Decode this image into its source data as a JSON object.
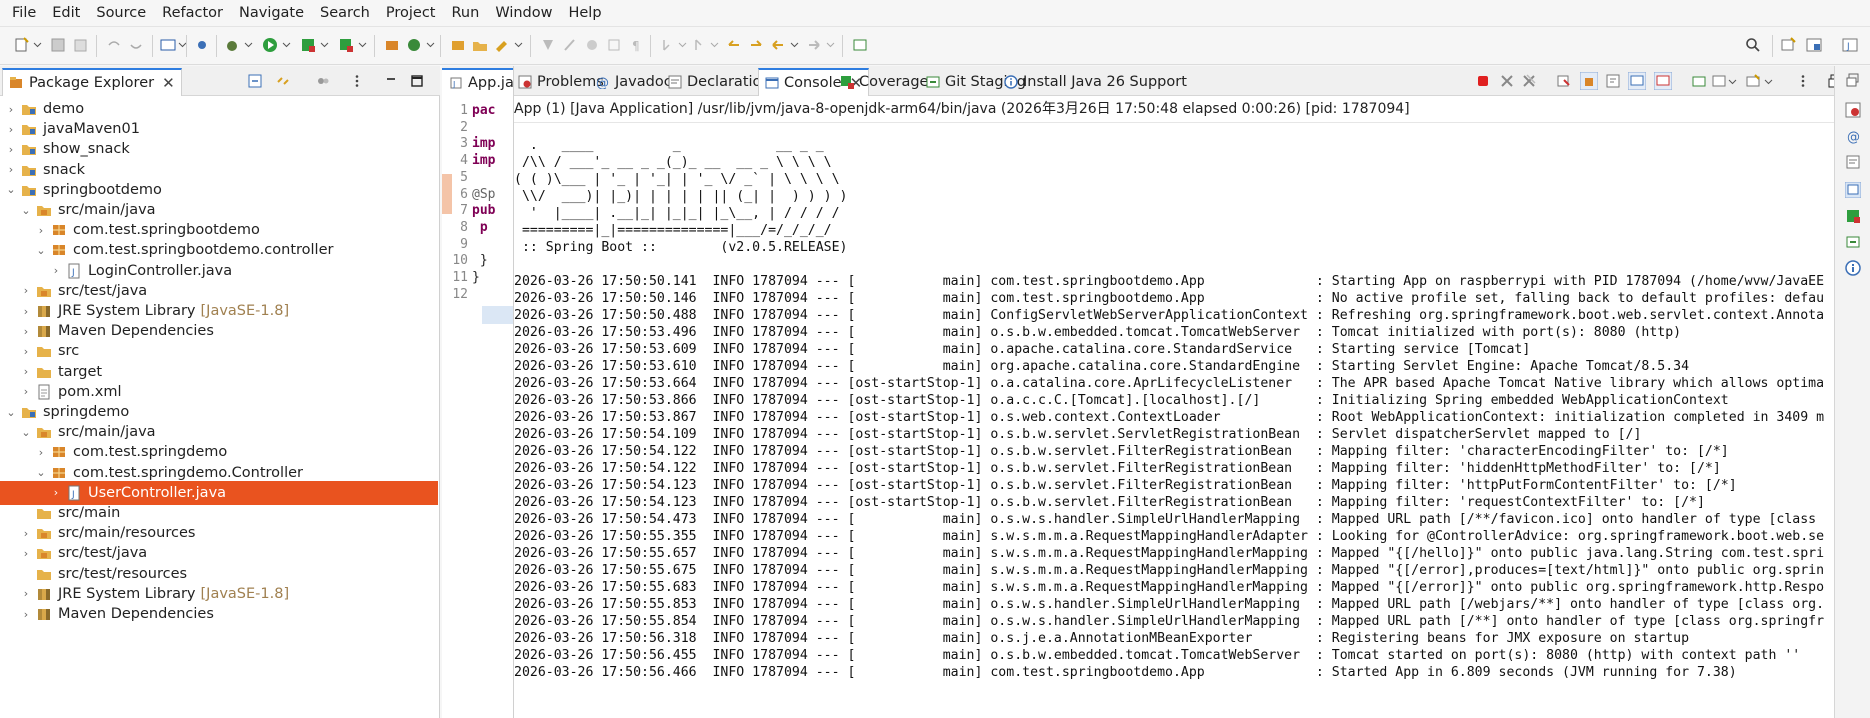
{
  "menu": [
    "File",
    "Edit",
    "Source",
    "Refactor",
    "Navigate",
    "Search",
    "Project",
    "Run",
    "Window",
    "Help"
  ],
  "package_explorer": {
    "title": "Package Explorer",
    "close": "✕",
    "tree": [
      {
        "label": "demo",
        "decor": "",
        "icon": "project-icon",
        "expanded": false
      },
      {
        "label": "javaMaven01",
        "decor": "",
        "icon": "project-icon",
        "expanded": false
      },
      {
        "label": "show_snack",
        "decor": "",
        "icon": "project-icon",
        "expanded": false
      },
      {
        "label": "snack",
        "decor": "",
        "icon": "project-icon",
        "expanded": false
      },
      {
        "label": "springbootdemo",
        "decor": "",
        "icon": "project-icon",
        "expanded": true
      },
      {
        "label": "src/main/java",
        "decor": "",
        "icon": "source-folder-icon",
        "expanded": true
      },
      {
        "label": "com.test.springbootdemo",
        "decor": "",
        "icon": "package-icon",
        "expanded": false
      },
      {
        "label": "com.test.springbootdemo.controller",
        "decor": "",
        "icon": "package-icon",
        "expanded": true
      },
      {
        "label": "LoginController.java",
        "decor": "",
        "icon": "java-file-icon",
        "expanded": false
      },
      {
        "label": "src/test/java",
        "decor": "",
        "icon": "source-folder-icon",
        "expanded": false
      },
      {
        "label": "JRE System Library",
        "decor": "[JavaSE-1.8]",
        "icon": "library-icon",
        "expanded": false
      },
      {
        "label": "Maven Dependencies",
        "decor": "",
        "icon": "library-icon",
        "expanded": false
      },
      {
        "label": "src",
        "decor": "",
        "icon": "folder-icon",
        "expanded": false
      },
      {
        "label": "target",
        "decor": "",
        "icon": "folder-icon",
        "expanded": false
      },
      {
        "label": "pom.xml",
        "decor": "",
        "icon": "xml-file-icon",
        "expanded": false
      },
      {
        "label": "springdemo",
        "decor": "",
        "icon": "project-icon",
        "expanded": true
      },
      {
        "label": "src/main/java",
        "decor": "",
        "icon": "source-folder-icon",
        "expanded": true
      },
      {
        "label": "com.test.springdemo",
        "decor": "",
        "icon": "package-icon",
        "expanded": false
      },
      {
        "label": "com.test.springdemo.Controller",
        "decor": "",
        "icon": "package-icon",
        "expanded": true
      },
      {
        "label": "UserController.java",
        "decor": "",
        "icon": "java-file-icon",
        "expanded": false,
        "selected": true
      },
      {
        "label": "src/main",
        "decor": "",
        "icon": "folder-icon",
        "expanded": null
      },
      {
        "label": "src/main/resources",
        "decor": "",
        "icon": "source-folder-icon",
        "expanded": false
      },
      {
        "label": "src/test/java",
        "decor": "",
        "icon": "source-folder-icon",
        "expanded": false
      },
      {
        "label": "src/test/resources",
        "decor": "",
        "icon": "folder-icon",
        "expanded": null
      },
      {
        "label": "JRE System Library",
        "decor": "[JavaSE-1.8]",
        "icon": "library-icon",
        "expanded": false
      },
      {
        "label": "Maven Dependencies",
        "decor": "",
        "icon": "library-icon",
        "expanded": false
      }
    ]
  },
  "editor": {
    "tab_label": "App.ja",
    "lines": [
      {
        "n": "1",
        "code": "pac",
        "style": "kw"
      },
      {
        "n": "2",
        "code": "",
        "style": "plain"
      },
      {
        "n": "3",
        "code": "imp",
        "style": "kw"
      },
      {
        "n": "4",
        "code": "imp",
        "style": "kw"
      },
      {
        "n": "5",
        "code": "",
        "style": "plain"
      },
      {
        "n": "6",
        "code": "@Sp",
        "style": "ann"
      },
      {
        "n": "7",
        "code": "pub",
        "style": "kw"
      },
      {
        "n": "8",
        "code": "  p",
        "style": "kw"
      },
      {
        "n": "9",
        "code": "",
        "style": "plain"
      },
      {
        "n": "10",
        "code": "  }",
        "style": "plain"
      },
      {
        "n": "11",
        "code": "}",
        "style": "plain"
      },
      {
        "n": "12",
        "code": "",
        "style": "plain"
      }
    ]
  },
  "console_tabs": [
    {
      "label": "Problems",
      "icon": "problems-icon"
    },
    {
      "label": "Javadoc",
      "icon": "at-icon"
    },
    {
      "label": "Declaration",
      "icon": "declaration-icon"
    },
    {
      "label": "Console",
      "icon": "console-icon",
      "active": true
    },
    {
      "label": "Coverage",
      "icon": "coverage-icon"
    },
    {
      "label": "Git Staging",
      "icon": "git-icon"
    },
    {
      "label": "Install Java 26 Support",
      "icon": "info-icon"
    }
  ],
  "console": {
    "description": "App (1) [Java Application] /usr/lib/jvm/java-8-openjdk-arm64/bin/java  (2026年3月26日 17:50:48 elapsed 0:00:26) [pid: 1787094]",
    "lines": [
      "  .   ____          _            __ _ _",
      " /\\\\ / ___'_ __ _ _(_)_ __  __ _ \\ \\ \\ \\",
      "( ( )\\___ | '_ | '_| | '_ \\/ _` | \\ \\ \\ \\",
      " \\\\/  ___)| |_)| | | | | || (_| |  ) ) ) )",
      "  '  |____| .__|_| |_|_| |_\\__, | / / / /",
      " =========|_|==============|___/=/_/_/_/",
      " :: Spring Boot ::        (v2.0.5.RELEASE)",
      "",
      "2026-03-26 17:50:50.141  INFO 1787094 --- [           main] com.test.springbootdemo.App              : Starting App on raspberrypi with PID 1787094 (/home/wvw/JavaEE",
      "2026-03-26 17:50:50.146  INFO 1787094 --- [           main] com.test.springbootdemo.App              : No active profile set, falling back to default profiles: defau",
      "2026-03-26 17:50:50.488  INFO 1787094 --- [           main] ConfigServletWebServerApplicationContext : Refreshing org.springframework.boot.web.servlet.context.Annota",
      "2026-03-26 17:50:53.496  INFO 1787094 --- [           main] o.s.b.w.embedded.tomcat.TomcatWebServer  : Tomcat initialized with port(s): 8080 (http)",
      "2026-03-26 17:50:53.609  INFO 1787094 --- [           main] o.apache.catalina.core.StandardService   : Starting service [Tomcat]",
      "2026-03-26 17:50:53.610  INFO 1787094 --- [           main] org.apache.catalina.core.StandardEngine  : Starting Servlet Engine: Apache Tomcat/8.5.34",
      "2026-03-26 17:50:53.664  INFO 1787094 --- [ost-startStop-1] o.a.catalina.core.AprLifecycleListener   : The APR based Apache Tomcat Native library which allows optima",
      "2026-03-26 17:50:53.866  INFO 1787094 --- [ost-startStop-1] o.a.c.c.C.[Tomcat].[localhost].[/]       : Initializing Spring embedded WebApplicationContext",
      "2026-03-26 17:50:53.867  INFO 1787094 --- [ost-startStop-1] o.s.web.context.ContextLoader            : Root WebApplicationContext: initialization completed in 3409 m",
      "2026-03-26 17:50:54.109  INFO 1787094 --- [ost-startStop-1] o.s.b.w.servlet.ServletRegistrationBean  : Servlet dispatcherServlet mapped to [/]",
      "2026-03-26 17:50:54.122  INFO 1787094 --- [ost-startStop-1] o.s.b.w.servlet.FilterRegistrationBean   : Mapping filter: 'characterEncodingFilter' to: [/*]",
      "2026-03-26 17:50:54.122  INFO 1787094 --- [ost-startStop-1] o.s.b.w.servlet.FilterRegistrationBean   : Mapping filter: 'hiddenHttpMethodFilter' to: [/*]",
      "2026-03-26 17:50:54.123  INFO 1787094 --- [ost-startStop-1] o.s.b.w.servlet.FilterRegistrationBean   : Mapping filter: 'httpPutFormContentFilter' to: [/*]",
      "2026-03-26 17:50:54.123  INFO 1787094 --- [ost-startStop-1] o.s.b.w.servlet.FilterRegistrationBean   : Mapping filter: 'requestContextFilter' to: [/*]",
      "2026-03-26 17:50:54.473  INFO 1787094 --- [           main] o.s.w.s.handler.SimpleUrlHandlerMapping  : Mapped URL path [/**/favicon.ico] onto handler of type [class ",
      "2026-03-26 17:50:55.355  INFO 1787094 --- [           main] s.w.s.m.m.a.RequestMappingHandlerAdapter : Looking for @ControllerAdvice: org.springframework.boot.web.se",
      "2026-03-26 17:50:55.657  INFO 1787094 --- [           main] s.w.s.m.m.a.RequestMappingHandlerMapping : Mapped \"{[/hello]}\" onto public java.lang.String com.test.spri",
      "2026-03-26 17:50:55.675  INFO 1787094 --- [           main] s.w.s.m.m.a.RequestMappingHandlerMapping : Mapped \"{[/error],produces=[text/html]}\" onto public org.sprin",
      "2026-03-26 17:50:55.683  INFO 1787094 --- [           main] s.w.s.m.m.a.RequestMappingHandlerMapping : Mapped \"{[/error]}\" onto public org.springframework.http.Respo",
      "2026-03-26 17:50:55.853  INFO 1787094 --- [           main] o.s.w.s.handler.SimpleUrlHandlerMapping  : Mapped URL path [/webjars/**] onto handler of type [class org.",
      "2026-03-26 17:50:55.854  INFO 1787094 --- [           main] o.s.w.s.handler.SimpleUrlHandlerMapping  : Mapped URL path [/**] onto handler of type [class org.springfr",
      "2026-03-26 17:50:56.318  INFO 1787094 --- [           main] o.s.j.e.a.AnnotationMBeanExporter        : Registering beans for JMX exposure on startup",
      "2026-03-26 17:50:56.455  INFO 1787094 --- [           main] o.s.b.w.embedded.tomcat.TomcatWebServer  : Tomcat started on port(s): 8080 (http) with context path ''",
      "2026-03-26 17:50:56.466  INFO 1787094 --- [           main] com.test.springbootdemo.App              : Started App in 6.809 seconds (JVM running for 7.38)"
    ]
  },
  "colors": {
    "selection": "#e9531f",
    "active_tab_accent": "#2e7de0",
    "terminate_red": "#e02020"
  }
}
